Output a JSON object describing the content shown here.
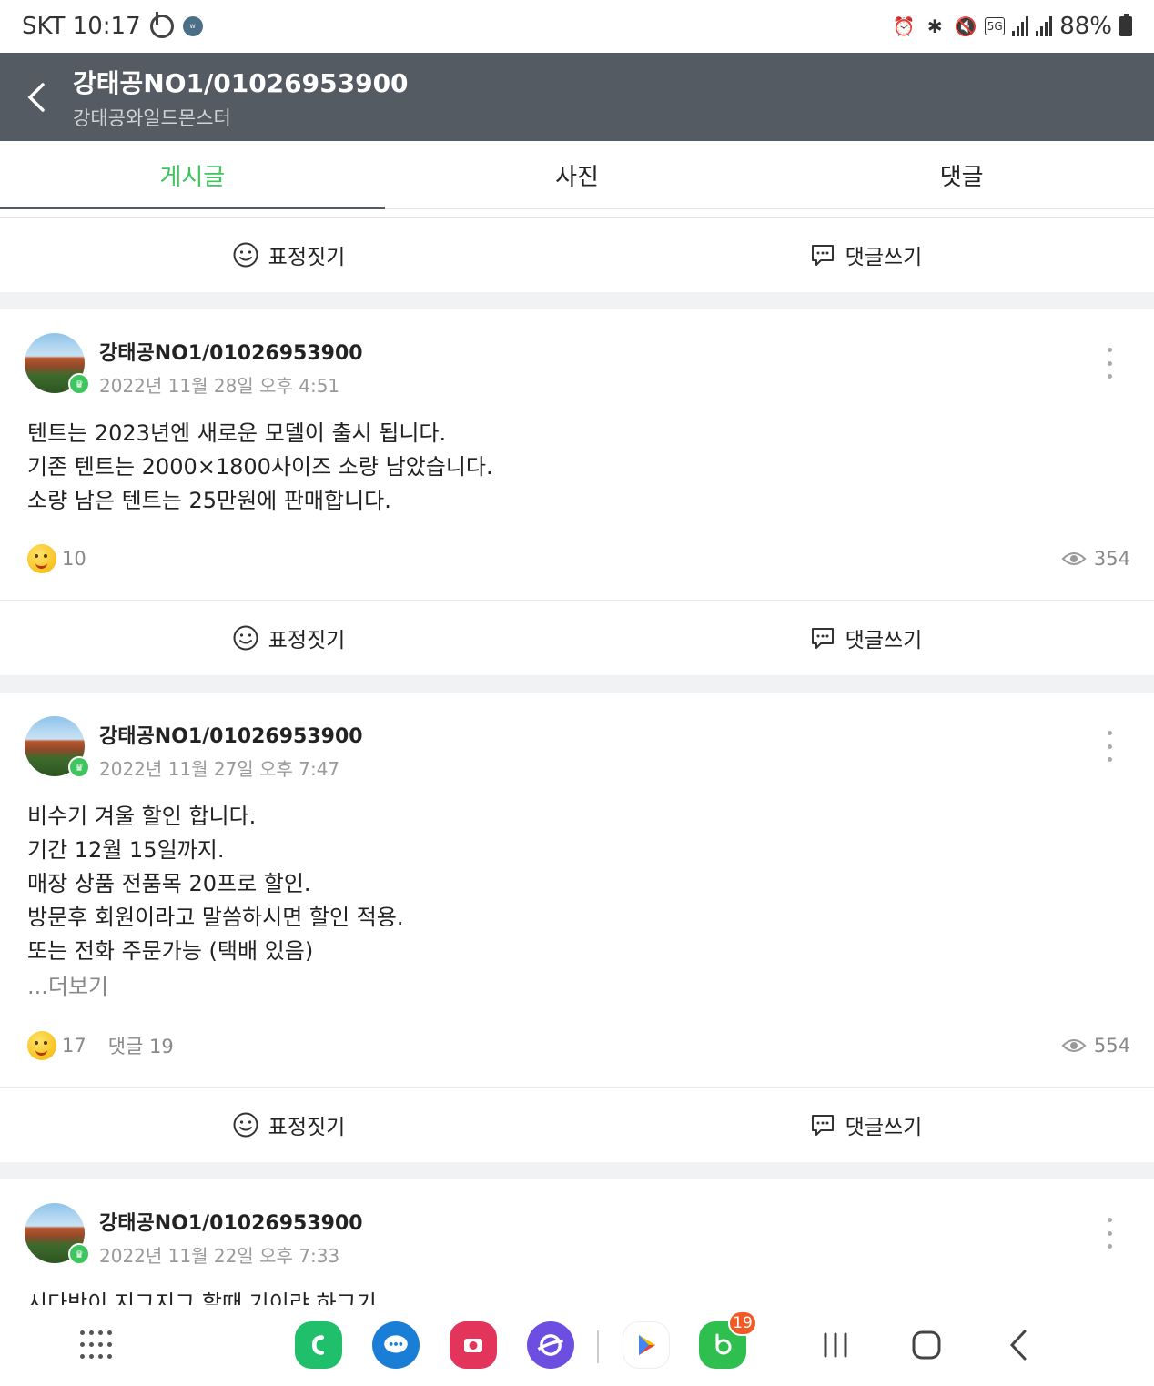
{
  "status_bar": {
    "carrier_time": "SKT 10:17",
    "battery": "88%",
    "icons": [
      "b-band-icon",
      "wear-icon",
      "alarm-icon",
      "bluetooth-icon",
      "mute-icon",
      "5g-icon",
      "signal-icon",
      "signal-icon",
      "battery-icon"
    ]
  },
  "header": {
    "title": "강태공NO1/01026953900",
    "subtitle": "강태공와일드몬스터"
  },
  "tabs": [
    {
      "label": "게시글",
      "active": true
    },
    {
      "label": "사진",
      "active": false
    },
    {
      "label": "댓글",
      "active": false
    }
  ],
  "actions": {
    "react_label": "표정짓기",
    "comment_label": "댓글쓰기"
  },
  "posts": [
    {
      "author": "강태공NO1/01026953900",
      "date": "2022년 11월 28일 오후 4:51",
      "lines": [
        "텐트는 2023년엔 새로운 모델이 출시 됩니다.",
        "기존 텐트는 2000×1800사이즈 소량 남았습니다.",
        "소량 남은 텐트는 25만원에 판매합니다."
      ],
      "reactions": "10",
      "views": "354"
    },
    {
      "author": "강태공NO1/01026953900",
      "date": "2022년 11월 27일 오후 7:47",
      "lines": [
        "비수기 겨울 할인 합니다.",
        "기간 12월 15일까지.",
        "매장 상품 전품목 20프로 할인.",
        "방문후 회원이라고 말씀하시면 할인 적용.",
        "또는 전화 주문가능 (택배 있음)"
      ],
      "more": "...더보기",
      "reactions": "17",
      "comments": "댓글 19",
      "views": "554"
    },
    {
      "author": "강태공NO1/01026953900",
      "date": "2022년 11월 22일 오후 7:33",
      "partial_line": "시다밧이 지그지그 할때 기이랴 하그기"
    }
  ],
  "navbar": {
    "apps": [
      "phone-app-icon",
      "messages-app-icon",
      "camera-app-icon",
      "internet-app-icon",
      "play-store-icon",
      "band-app-icon"
    ],
    "band_badge": "19"
  }
}
